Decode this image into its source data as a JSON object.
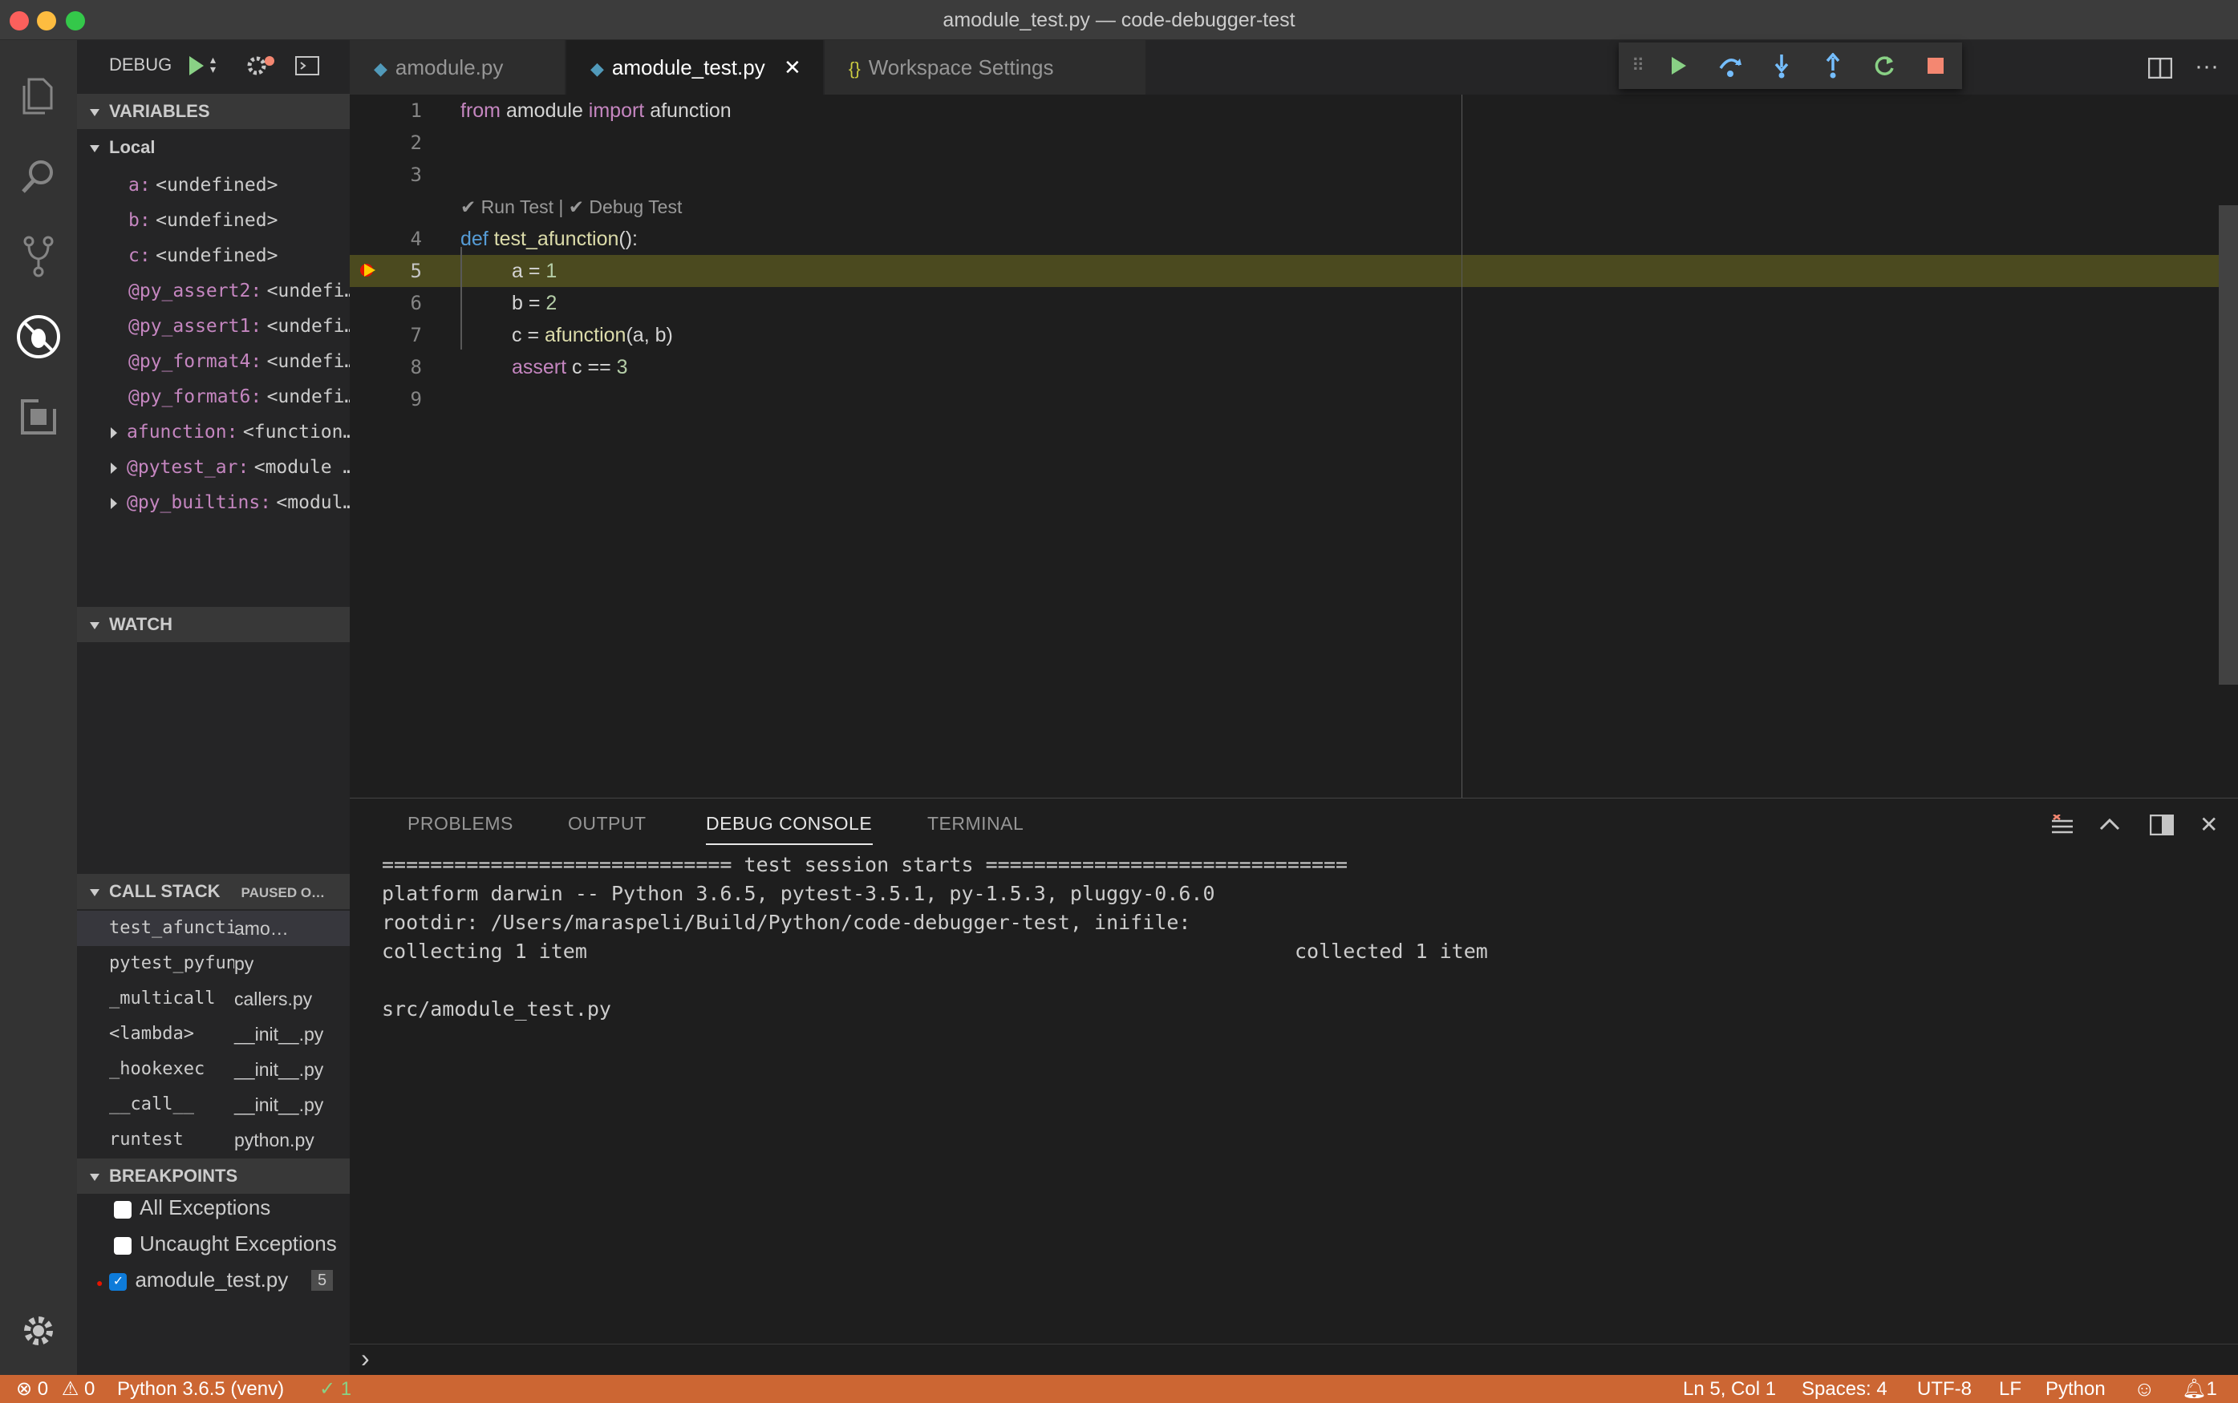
{
  "window": {
    "title": "amodule_test.py — code-debugger-test"
  },
  "debug_header": {
    "label": "DEBUG"
  },
  "tabs": [
    {
      "label": "amodule.py"
    },
    {
      "label": "amodule_test.py"
    },
    {
      "label": "Workspace Settings"
    }
  ],
  "sidebar": {
    "variables": {
      "title": "VARIABLES",
      "scope": "Local",
      "items": [
        {
          "name": "a:",
          "value": "<undefined>"
        },
        {
          "name": "b:",
          "value": "<undefined>"
        },
        {
          "name": "c:",
          "value": "<undefined>"
        },
        {
          "name": "@py_assert2:",
          "value": "<undefi…"
        },
        {
          "name": "@py_assert1:",
          "value": "<undefi…"
        },
        {
          "name": "@py_format4:",
          "value": "<undefi…"
        },
        {
          "name": "@py_format6:",
          "value": "<undefi…"
        },
        {
          "name": "afunction:",
          "value": "<function…"
        },
        {
          "name": "@pytest_ar:",
          "value": "<module …"
        },
        {
          "name": "@py_builtins:",
          "value": "<modul…"
        }
      ]
    },
    "watch": {
      "title": "WATCH"
    },
    "callstack": {
      "title": "CALL STACK",
      "status": "PAUSED O…",
      "frames": [
        {
          "fn": "test_afunction",
          "file": "amo…"
        },
        {
          "fn": "pytest_pyfunc_call",
          "file": "py"
        },
        {
          "fn": "_multicall",
          "file": "callers.py"
        },
        {
          "fn": "<lambda>",
          "file": "__init__.py"
        },
        {
          "fn": "_hookexec",
          "file": "__init__.py"
        },
        {
          "fn": "__call__",
          "file": "__init__.py"
        },
        {
          "fn": "runtest",
          "file": "python.py"
        }
      ]
    },
    "breakpoints": {
      "title": "BREAKPOINTS",
      "items": [
        {
          "label": "All Exceptions",
          "checked": false
        },
        {
          "label": "Uncaught Exceptions",
          "checked": false
        },
        {
          "label": "amodule_test.py",
          "checked": true,
          "line": "5"
        }
      ]
    }
  },
  "editor": {
    "codelens": "✔ Run Test | ✔ Debug Test",
    "line_numbers": [
      "1",
      "2",
      "3",
      "4",
      "5",
      "6",
      "7",
      "8",
      "9"
    ],
    "lines": {
      "l1": {
        "kw1": "from",
        "mod": " amodule ",
        "kw2": "import",
        "rest": " afunction"
      },
      "l4": {
        "kw": "def",
        "fn": " test_afunction",
        "rest": "():"
      },
      "l5": {
        "var": "a = ",
        "num": "1"
      },
      "l6": {
        "var": "b = ",
        "num": "2"
      },
      "l7": {
        "var": "c = ",
        "fn": "afunction",
        "rest": "(a, b)"
      },
      "l8": {
        "kw": "assert",
        "rest": " c == ",
        "num": "3"
      }
    }
  },
  "panel": {
    "tabs": [
      "PROBLEMS",
      "OUTPUT",
      "DEBUG CONSOLE",
      "TERMINAL"
    ],
    "console": [
      "============================= test session starts ==============================",
      "platform darwin -- Python 3.6.5, pytest-3.5.1, py-1.5.3, pluggy-0.6.0",
      "rootdir: /Users/maraspeli/Build/Python/code-debugger-test, inifile:",
      "collecting 1 item",
      "collected 1 item",
      "src/amodule_test.py"
    ],
    "prompt": "›"
  },
  "statusbar": {
    "errors": "0",
    "warnings": "0",
    "interpreter": "Python 3.6.5 (venv)",
    "tests": "✓ 1",
    "position": "Ln 5, Col 1",
    "spaces": "Spaces: 4",
    "encoding": "UTF-8",
    "eol": "LF",
    "language": "Python",
    "notifications": "1"
  },
  "colors": {
    "statusbar": "#cc6633",
    "accent_green": "#89d185",
    "stop_red": "#f48771",
    "highlight_line": "#4b4a1f"
  }
}
